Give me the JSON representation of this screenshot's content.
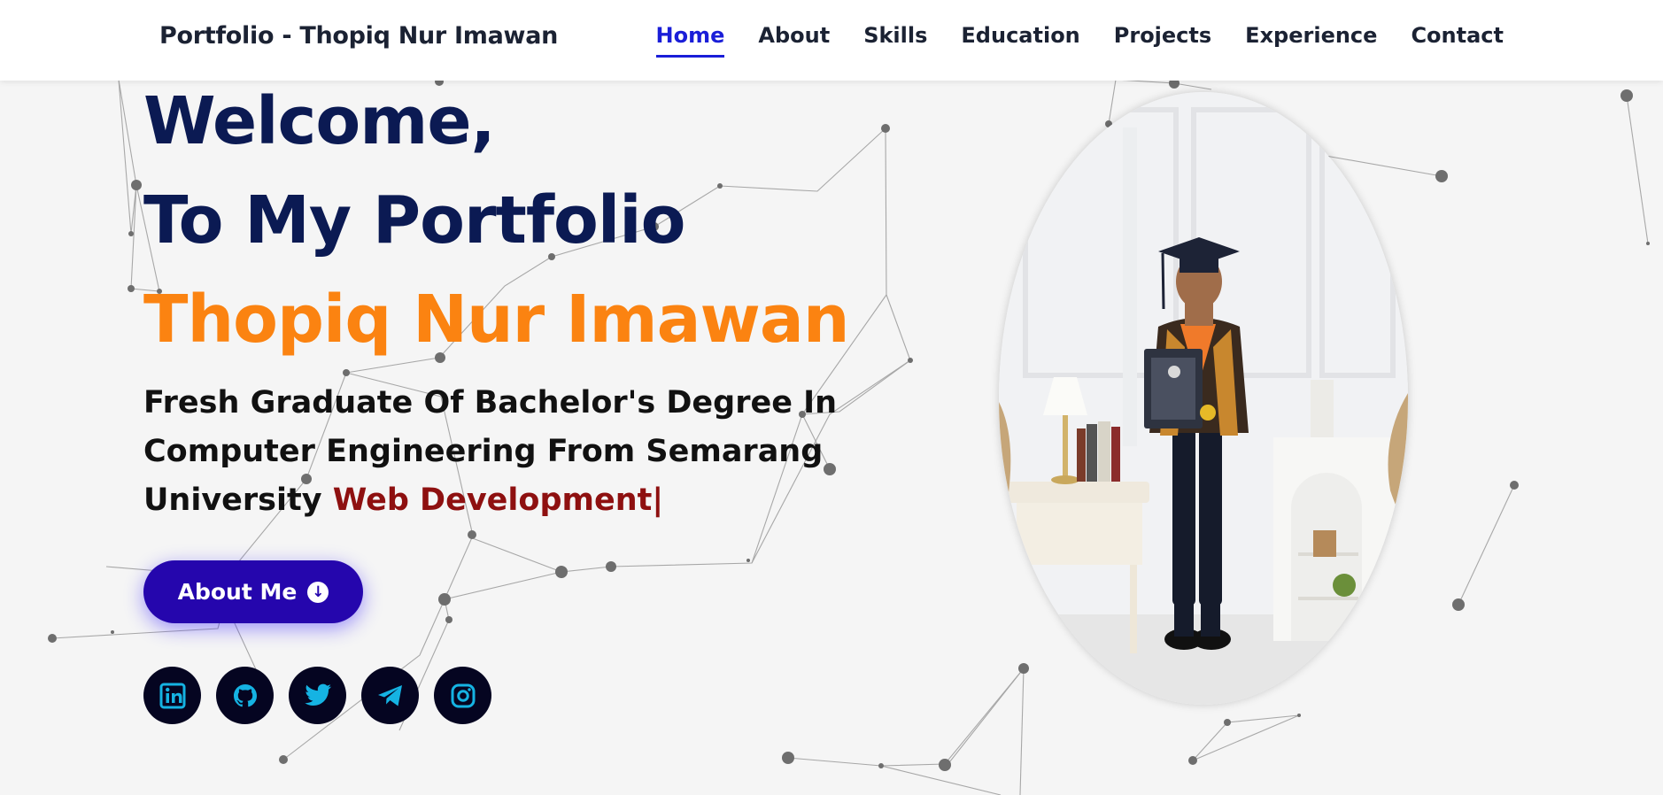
{
  "navbar": {
    "brand": "Portfolio - Thopiq Nur Imawan",
    "links": [
      {
        "label": "Home",
        "active": true
      },
      {
        "label": "About"
      },
      {
        "label": "Skills"
      },
      {
        "label": "Education"
      },
      {
        "label": "Projects"
      },
      {
        "label": "Experience"
      },
      {
        "label": "Contact"
      }
    ]
  },
  "hero": {
    "line1": "Welcome,",
    "line2": "To My Portfolio",
    "name": "Thopiq Nur Imawan",
    "subtitle": "Fresh Graduate Of Bachelor's Degree In Computer Engineering From Semarang University",
    "typed": "Web Development",
    "cursor": "|",
    "about_button": "About Me"
  },
  "social": [
    {
      "icon": "linkedin-icon"
    },
    {
      "icon": "github-icon"
    },
    {
      "icon": "twitter-icon"
    },
    {
      "icon": "telegram-icon"
    },
    {
      "icon": "instagram-icon"
    }
  ],
  "photo": {
    "description_icon": "profile-photo"
  },
  "colors": {
    "nav_active": "#1a1ed8",
    "heading": "#0b1a53",
    "name": "#fb8311",
    "typed": "#8e1010",
    "button": "#2506ad",
    "social_bg": "#050521",
    "social_icon": "#15b3e3"
  }
}
